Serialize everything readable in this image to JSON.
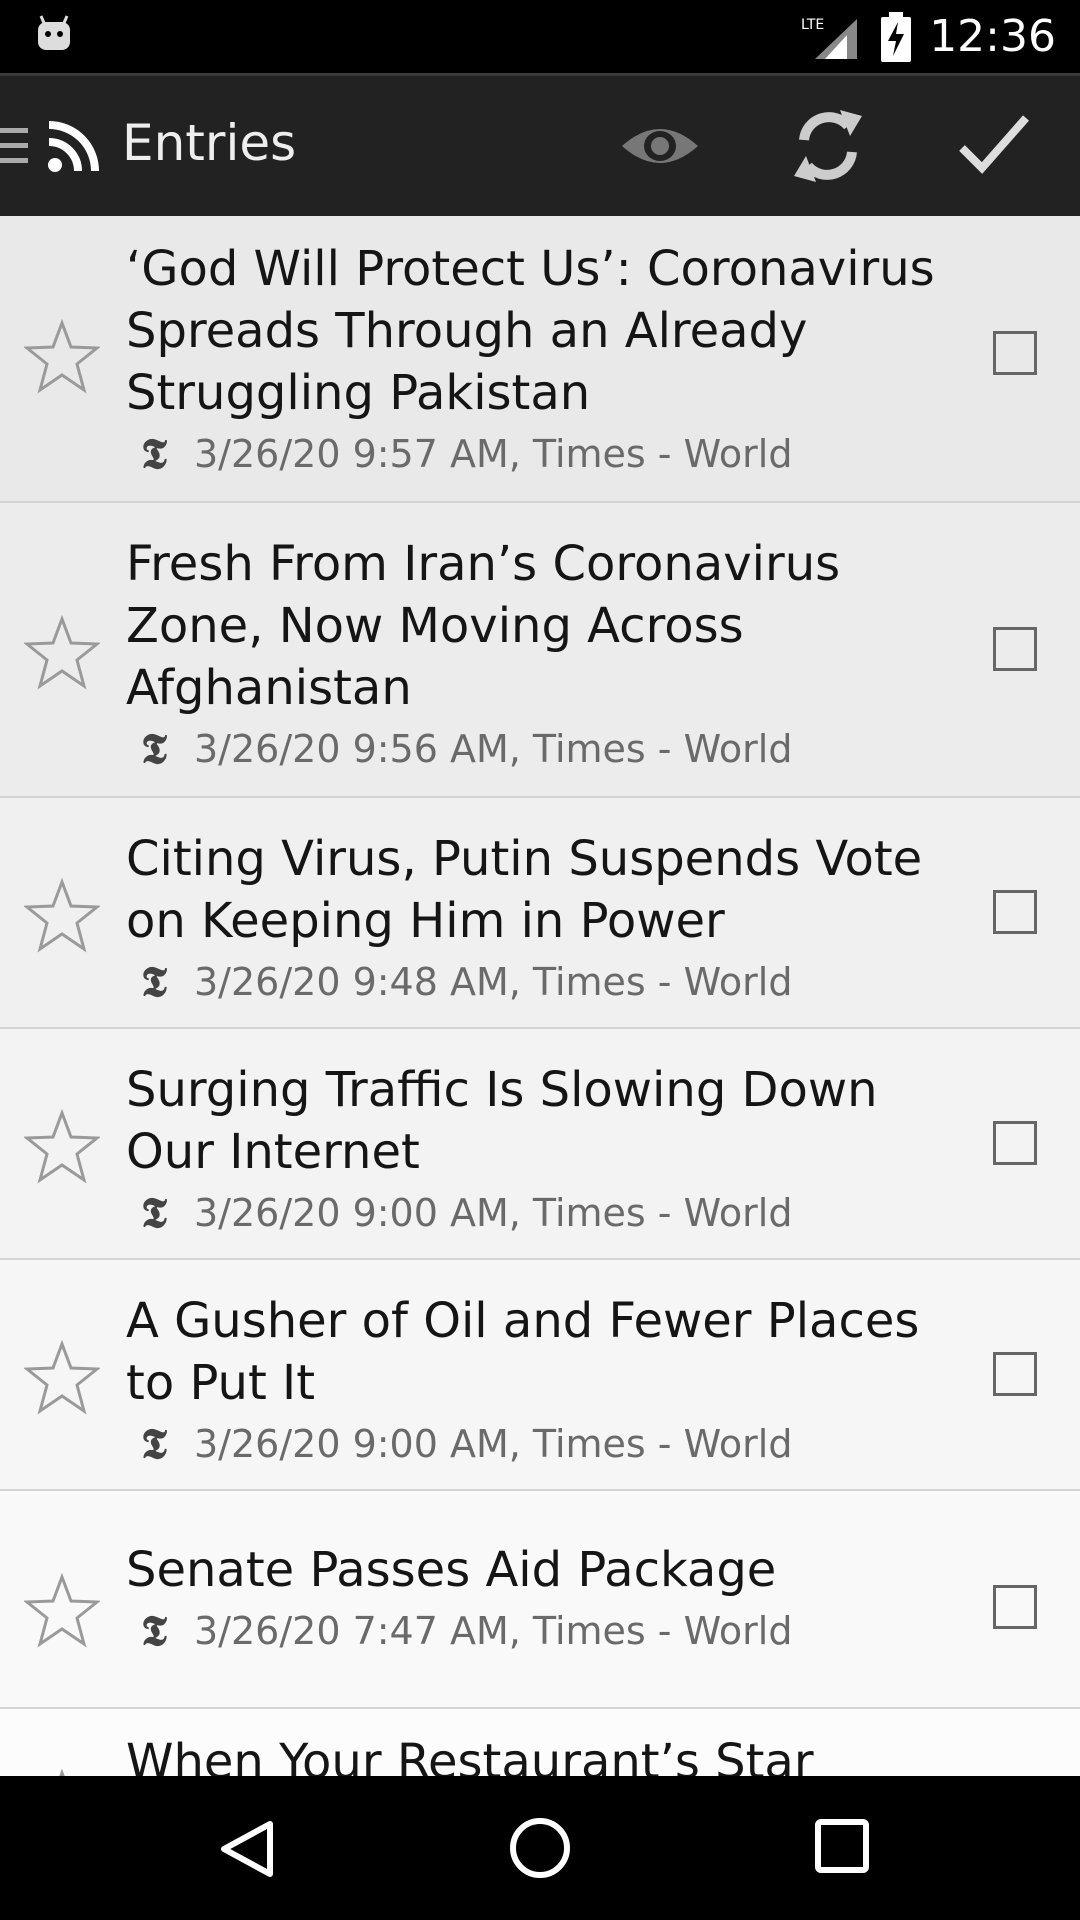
{
  "status_bar": {
    "time": "12:36",
    "network_label": "LTE",
    "icons": [
      "android-debug-icon",
      "lte-signal-icon",
      "battery-charging-icon"
    ]
  },
  "action_bar": {
    "title": "Entries",
    "icons": [
      "drawer-menu-icon",
      "rss-icon",
      "eye-icon",
      "refresh-icon",
      "mark-read-check-icon"
    ]
  },
  "entries": [
    {
      "title": "‘God Will Protect Us’: Coronavirus Spreads Through an Already Struggling Pakistan",
      "meta": "3/26/20 9:57 AM, Times - World",
      "starred": false,
      "checked": false
    },
    {
      "title": "Fresh From Iran’s Coronavirus Zone, Now Moving Across Afghanistan",
      "meta": "3/26/20 9:56 AM, Times - World",
      "starred": false,
      "checked": false
    },
    {
      "title": "Citing Virus, Putin Suspends Vote on Keeping Him in Power",
      "meta": "3/26/20 9:48 AM, Times - World",
      "starred": false,
      "checked": false
    },
    {
      "title": "Surging Traffic Is Slowing Down Our Internet",
      "meta": "3/26/20 9:00 AM, Times - World",
      "starred": false,
      "checked": false
    },
    {
      "title": "A Gusher of Oil and Fewer Places to Put It",
      "meta": "3/26/20 9:00 AM, Times - World",
      "starred": false,
      "checked": false
    },
    {
      "title": "Senate Passes Aid Package",
      "meta": "3/26/20 7:47 AM, Times - World",
      "starred": false,
      "checked": false
    },
    {
      "title": "When Your Restaurant’s Star",
      "meta": "",
      "starred": false,
      "checked": false
    }
  ],
  "source_logo": "𝕿",
  "nav_bar": {
    "icons": [
      "back-icon",
      "home-icon",
      "recents-icon"
    ]
  },
  "colors": {
    "action_bar": "#222222",
    "status_bar": "#000000",
    "list_bg": "#f2f2f2",
    "title_text": "#151515",
    "meta_text": "#6a6a6a"
  }
}
